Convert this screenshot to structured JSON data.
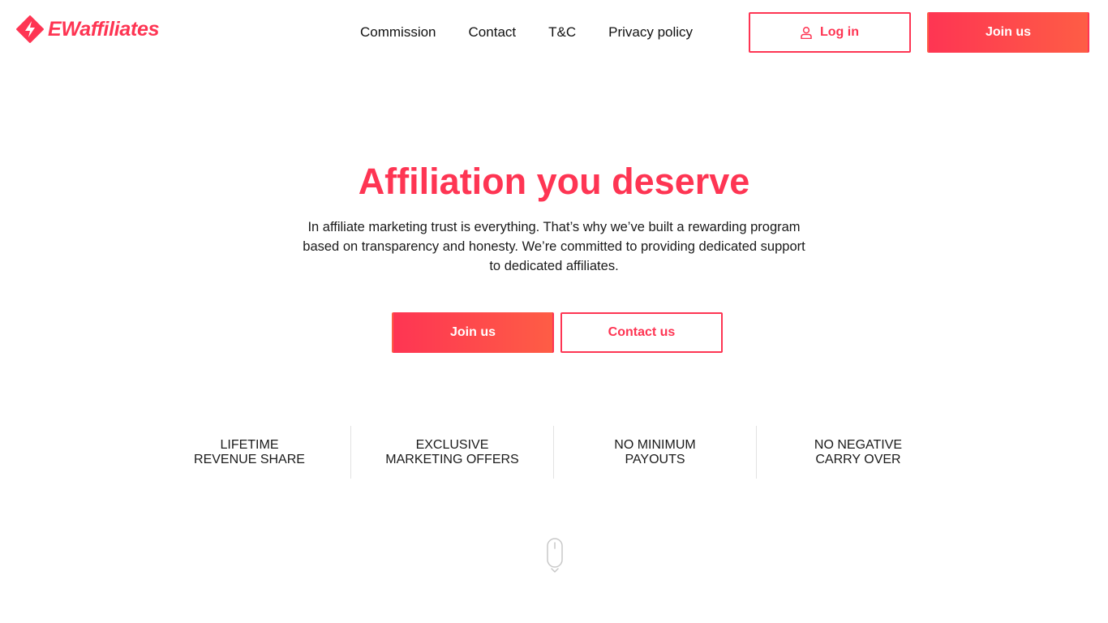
{
  "header": {
    "brand": "EWaffiliates",
    "nav": [
      {
        "label": "Commission"
      },
      {
        "label": "Contact"
      },
      {
        "label": "T&C"
      },
      {
        "label": "Privacy policy"
      }
    ],
    "login_label": "Log in",
    "join_label": "Join us"
  },
  "hero": {
    "title": "Affiliation you deserve",
    "text": "In affiliate marketing trust is everything. That’s why we’ve built a rewarding program based on transparency and honesty. We’re committed to providing dedicated support to dedicated affiliates.",
    "join_label": "Join us",
    "contact_label": "Contact us"
  },
  "features": [
    {
      "text": "LIFETIME\nREVENUE SHARE"
    },
    {
      "text": "EXCLUSIVE\nMARKETING OFFERS"
    },
    {
      "text": "NO MINIMUM\nPAYOUTS"
    },
    {
      "text": "NO NEGATIVE\nCARRY OVER"
    }
  ],
  "icons": {
    "logo": "lightning-diamond-icon",
    "login": "user-icon",
    "scroll": "mouse-scroll-icon"
  },
  "colors": {
    "accent": "#fe3553",
    "accent_gradient_end": "#fe5d45",
    "text": "#1a1a1a",
    "divider": "#e2e2e2"
  }
}
